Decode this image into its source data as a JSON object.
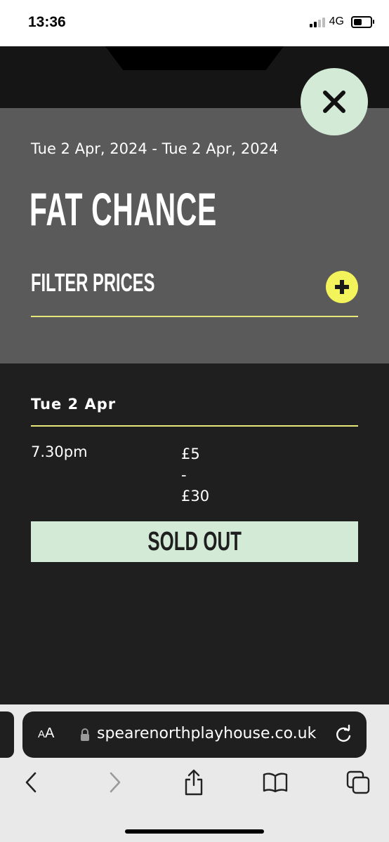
{
  "status_bar": {
    "time": "13:36",
    "network": "4G"
  },
  "show": {
    "date_range": "Tue 2 Apr, 2024 - Tue 2 Apr, 2024",
    "title": "FAT CHANCE",
    "filter_label": "FILTER PRICES"
  },
  "schedule": {
    "day": "Tue 2 Apr",
    "performances": [
      {
        "time": "7.30pm",
        "price_from": "£5",
        "price_sep": "-",
        "price_to": "£30",
        "status": "SOLD OUT"
      }
    ]
  },
  "browser": {
    "text_size_big": "A",
    "text_size_small": "A",
    "url": "spearenorthplayhouse.co.uk"
  },
  "colors": {
    "panel": "#5a5a5a",
    "background": "#1f1f1f",
    "accent_yellow": "#f3f35b",
    "accent_mint": "#d3ead6"
  },
  "icons": {
    "close": "close-icon",
    "filter_toggle": "plus-icon",
    "lock": "lock-icon",
    "reload": "reload-icon",
    "back": "chevron-left-icon",
    "forward": "chevron-right-icon",
    "share": "share-icon",
    "bookmarks": "book-icon",
    "tabs": "tabs-icon"
  }
}
